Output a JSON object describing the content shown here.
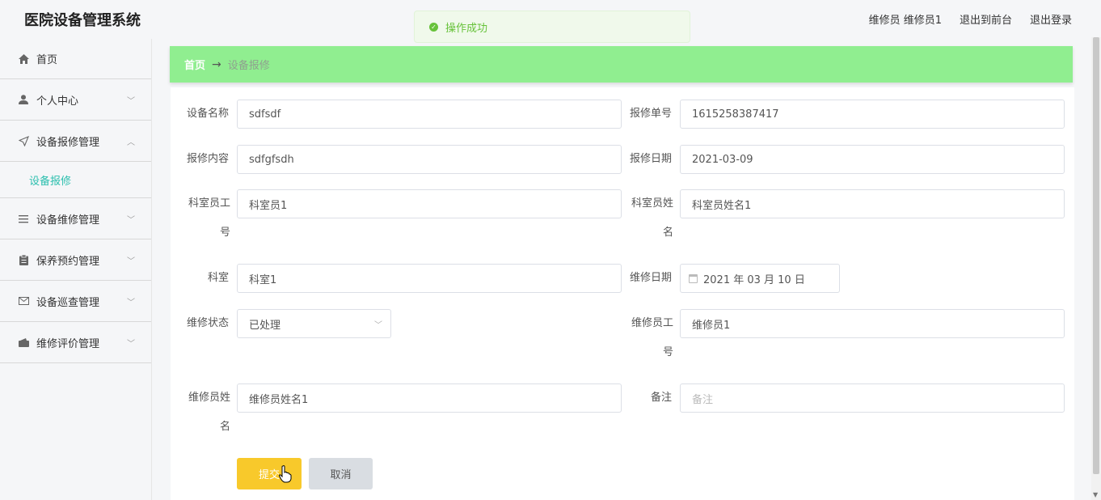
{
  "app": {
    "title": "医院设备管理系统"
  },
  "header": {
    "user": "维修员 维修员1",
    "front": "退出到前台",
    "logout": "退出登录"
  },
  "toast": {
    "message": "操作成功",
    "icon": "check-circle-icon"
  },
  "sidebar": {
    "items": [
      {
        "label": "首页",
        "icon": "home-icon"
      },
      {
        "label": "个人中心",
        "icon": "user-icon"
      },
      {
        "label": "设备报修管理",
        "icon": "send-icon"
      },
      {
        "label": "设备维修管理",
        "icon": "list-icon"
      },
      {
        "label": "保养预约管理",
        "icon": "clipboard-icon"
      },
      {
        "label": "设备巡查管理",
        "icon": "mail-icon"
      },
      {
        "label": "维修评价管理",
        "icon": "wallet-icon"
      }
    ],
    "active_sub": "设备报修"
  },
  "breadcrumb": {
    "home": "首页",
    "sep": "→",
    "current": "设备报修"
  },
  "form": {
    "device_name": {
      "label": "设备名称",
      "value": "sdfsdf"
    },
    "repair_no": {
      "label": "报修单号",
      "value": "1615258387417"
    },
    "repair_content": {
      "label": "报修内容",
      "value": "sdfgfsdh"
    },
    "repair_date": {
      "label": "报修日期",
      "value": "2021-03-09"
    },
    "staff_id": {
      "label": "科室员工号",
      "value": "科室员1"
    },
    "staff_name": {
      "label": "科室员姓名",
      "value": "科室员姓名1"
    },
    "dept": {
      "label": "科室",
      "value": "科室1"
    },
    "maint_date": {
      "label": "维修日期",
      "value": "2021 年 03 月 10 日"
    },
    "status": {
      "label": "维修状态",
      "value": "已处理"
    },
    "tech_id": {
      "label": "维修员工号",
      "value": "维修员1"
    },
    "tech_name": {
      "label": "维修员姓名",
      "value": "维修员姓名1"
    },
    "remark": {
      "label": "备注",
      "placeholder": "备注"
    },
    "submit": "提交",
    "cancel": "取消"
  },
  "colors": {
    "accent": "#2bbfae",
    "breadcrumb_bg": "#90ee90",
    "submit_bg": "#f8c92b",
    "toast_bg": "#f0f9eb"
  }
}
